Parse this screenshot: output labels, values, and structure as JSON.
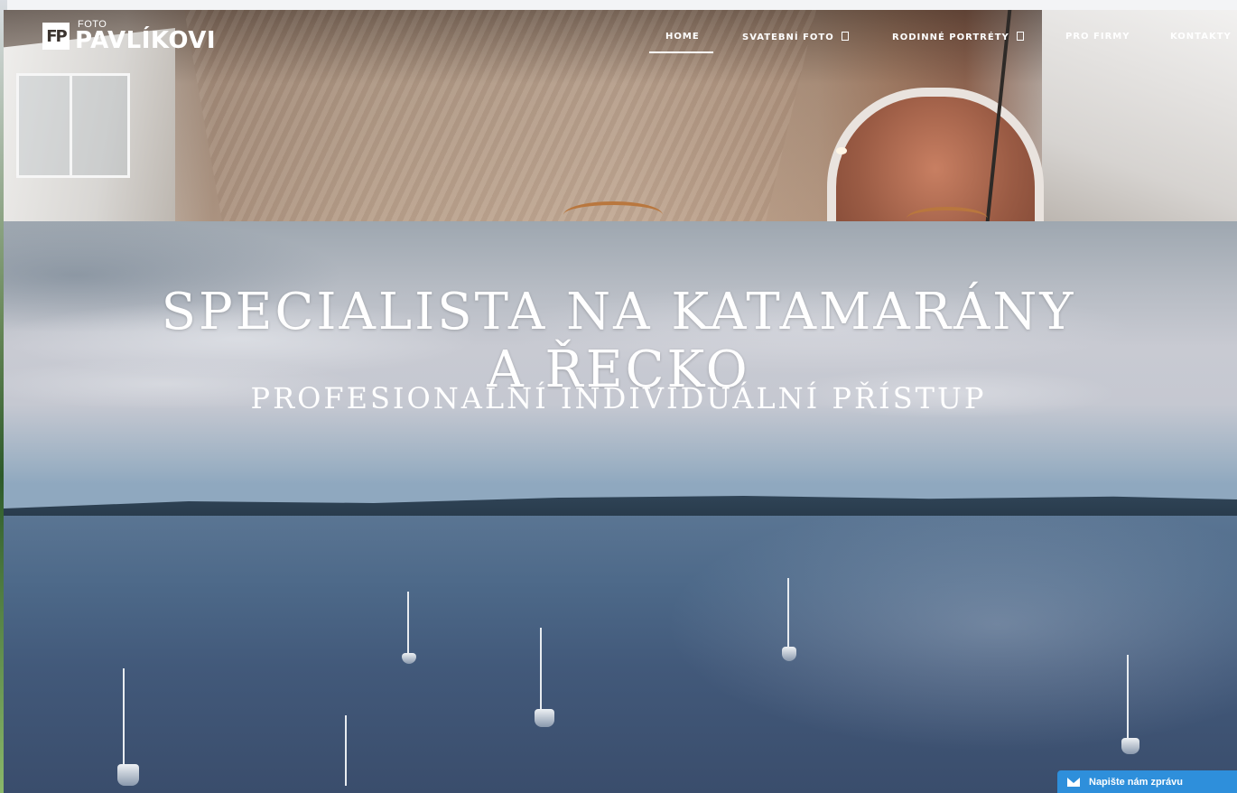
{
  "logo": {
    "mark": "FP",
    "small": "FOTO",
    "big": "PAVLÍKOVI"
  },
  "nav": {
    "items": [
      {
        "label": "HOME",
        "active": true,
        "dropdown": false
      },
      {
        "label": "SVATEBNÍ FOTO",
        "active": false,
        "dropdown": true
      },
      {
        "label": "RODINNÉ PORTRÉTY",
        "active": false,
        "dropdown": true
      },
      {
        "label": "PRO FIRMY",
        "active": false,
        "dropdown": false
      },
      {
        "label": "KONTAKTY",
        "active": false,
        "dropdown": false
      }
    ]
  },
  "hero": {
    "title_line1": "SPECIALISTA NA KATAMARÁNY",
    "title_line2": "A ŘECKO",
    "subtitle": "PROFESIONALNÍ INDIVIDUÁLNÍ PŘÍSTUP"
  },
  "chat": {
    "label": "Napište nám zprávu",
    "icon": "envelope-icon"
  },
  "colors": {
    "chat_bg": "#2e8fdb",
    "nav_text": "#ffffff",
    "hero_text": "#ffffff"
  }
}
